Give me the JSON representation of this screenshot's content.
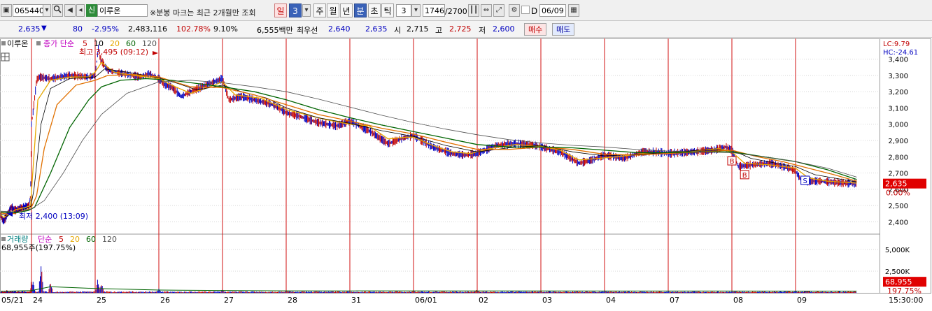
{
  "toolbar": {
    "code_value": "065440",
    "badge": "신",
    "stock_name": "이루온",
    "notice": "※분봉 마크는 최근 2개월만 조회",
    "period_day": "일",
    "period_value": "3",
    "period_week": "주",
    "period_month": "월",
    "period_year": "년",
    "period_minute": "분",
    "period_second": "초",
    "period_tick": "틱",
    "interval_value": "3",
    "count_display": "1746",
    "count_total": "/2700",
    "date_flag": "D",
    "date_value": "06/09"
  },
  "quote": {
    "price": "2,635",
    "change_arrow": "▼",
    "change": "80",
    "change_pct": "-2.95%",
    "volume": "2,483,116",
    "volume_ratio": "102.78%",
    "turnover": "9.10%",
    "amount": "6,555백만",
    "ask_label": "최우선",
    "ask": "2,640",
    "bid": "2,635",
    "open_label": "시",
    "open": "2,715",
    "high_label": "고",
    "high": "2,725",
    "low_label": "저",
    "low": "2,600",
    "buy_label": "매수",
    "sell_label": "매도"
  },
  "colors": {
    "up": "#c00000",
    "down": "#0000c0",
    "ma5": "#e6a800",
    "ma10": "#000000",
    "ma20": "#e07000",
    "ma60": "#006400",
    "ma120": "#505050",
    "vline": "#d01010",
    "grid": "#d8d8d8",
    "price_tag_bg": "#e00000"
  },
  "icons": [
    "window-icon",
    "dropdown-arrow-icon",
    "search-icon",
    "speaker-icon",
    "prev-icon",
    "next-icon",
    "candle-icon",
    "fit-icon",
    "settings-icon",
    "calendar-icon"
  ],
  "chart_data": {
    "type": "line",
    "main_legend": {
      "name": "이루온",
      "kind": "종가 단순",
      "ma": [
        "5",
        "10",
        "20",
        "60",
        "120"
      ]
    },
    "right_info": {
      "lc": "LC:9.79",
      "hc": "HC:-24.61"
    },
    "annotations": {
      "max_label": "최고 3,495 (09:12)",
      "min_label": "최저 2,400 (13:09)"
    },
    "price_ticks": [
      "3,400",
      "3,300",
      "3,200",
      "3,100",
      "3,000",
      "2,900",
      "2,800",
      "2,700",
      "2,600",
      "2,500",
      "2,400"
    ],
    "price_tick_values": [
      3400,
      3300,
      3200,
      3100,
      3000,
      2900,
      2800,
      2700,
      2600,
      2500,
      2400
    ],
    "last_price_label": "2,635",
    "last_pct_label": "0.00%",
    "volume_legend": {
      "name": "거래량",
      "kind": "단순",
      "ma": [
        "5",
        "20",
        "60",
        "120"
      ],
      "value": "68,955주(197.75%)"
    },
    "volume_ticks": [
      "5,000K",
      "2,500K"
    ],
    "volume_tick_values": [
      5000,
      2500
    ],
    "last_volume_label": "68,955",
    "last_volume_pct_label": "197.75%",
    "x_labels": [
      "05/21",
      "24",
      "25",
      "26",
      "27",
      "28",
      "31",
      "06/01",
      "02",
      "03",
      "04",
      "07",
      "08",
      "09"
    ],
    "time_label": "15:30:00",
    "ylim": [
      2350,
      3510
    ],
    "series": [
      {
        "name": "종가",
        "x": [
          0,
          0.05,
          0.1,
          0.2,
          0.28,
          0.35,
          0.45,
          0.6,
          0.8,
          0.92,
          0.97,
          1.0,
          1.03,
          1.08,
          1.12,
          1.3,
          1.6,
          1.9,
          2.0,
          2.05,
          2.08,
          2.2,
          2.45,
          2.7,
          2.85,
          3.0,
          3.1,
          3.2,
          3.35,
          3.5,
          3.8,
          4.0,
          4.1,
          4.3,
          4.5,
          4.8,
          5.0,
          5.2,
          5.5,
          5.8,
          6.0,
          6.3,
          6.6,
          6.8,
          7.0,
          7.3,
          7.6,
          7.8,
          8.0,
          8.3,
          8.6,
          8.9,
          9.0,
          9.3,
          9.6,
          9.8,
          10.0,
          10.3,
          10.6,
          10.8,
          11.0,
          11.4,
          11.7,
          11.9,
          12.0,
          12.1,
          12.3,
          12.6,
          12.9,
          13.0,
          13.1,
          13.4,
          13.7,
          13.96
        ],
        "values": [
          2440,
          2415,
          2405,
          2440,
          2470,
          2490,
          2470,
          2480,
          2495,
          2500,
          2560,
          3000,
          3090,
          3270,
          3290,
          3280,
          3300,
          3290,
          3300,
          3470,
          3400,
          3330,
          3310,
          3290,
          3310,
          3280,
          3240,
          3230,
          3170,
          3200,
          3250,
          3280,
          3150,
          3170,
          3150,
          3120,
          3070,
          3050,
          3010,
          2990,
          3020,
          2960,
          2880,
          2910,
          2930,
          2860,
          2820,
          2810,
          2820,
          2870,
          2880,
          2870,
          2860,
          2830,
          2760,
          2780,
          2810,
          2790,
          2830,
          2830,
          2820,
          2830,
          2840,
          2860,
          2840,
          2740,
          2750,
          2760,
          2730,
          2710,
          2650,
          2650,
          2640,
          2635
        ]
      },
      {
        "name": "5",
        "x": [
          0,
          0.1,
          0.3,
          0.5,
          0.8,
          0.97,
          1.02,
          1.1,
          1.3,
          1.6,
          1.9,
          2.0,
          2.1,
          2.3,
          2.6,
          3.0,
          3.2,
          3.5,
          3.8,
          4.0,
          4.2,
          4.6,
          5.0,
          5.3,
          5.6,
          6.0,
          6.3,
          6.6,
          6.9,
          7.0,
          7.3,
          7.6,
          7.9,
          8.2,
          8.6,
          9.0,
          9.3,
          9.6,
          9.9,
          10.2,
          10.6,
          11.0,
          11.4,
          11.8,
          12.0,
          12.2,
          12.6,
          13.0,
          13.2,
          13.5,
          13.96
        ],
        "values": [
          2445,
          2425,
          2455,
          2475,
          2488,
          2500,
          2700,
          3150,
          3270,
          3290,
          3290,
          3320,
          3380,
          3320,
          3300,
          3280,
          3240,
          3190,
          3230,
          3260,
          3180,
          3160,
          3090,
          3060,
          3030,
          3000,
          2990,
          2910,
          2920,
          2920,
          2870,
          2830,
          2820,
          2850,
          2875,
          2865,
          2840,
          2780,
          2790,
          2800,
          2820,
          2825,
          2835,
          2850,
          2830,
          2760,
          2750,
          2730,
          2670,
          2650,
          2638
        ]
      },
      {
        "name": "10",
        "x": [
          0,
          0.2,
          0.5,
          0.8,
          0.98,
          1.04,
          1.15,
          1.3,
          1.6,
          2.0,
          2.15,
          2.5,
          3.0,
          3.3,
          3.6,
          4.0,
          4.3,
          4.7,
          5.0,
          5.5,
          6.0,
          6.5,
          7.0,
          7.5,
          8.0,
          8.5,
          9.0,
          9.5,
          10.0,
          10.5,
          11.0,
          11.5,
          12.0,
          12.3,
          12.7,
          13.0,
          13.3,
          13.96
        ],
        "values": [
          2450,
          2435,
          2460,
          2480,
          2495,
          2600,
          3000,
          3220,
          3280,
          3290,
          3340,
          3320,
          3285,
          3250,
          3210,
          3240,
          3200,
          3160,
          3100,
          3040,
          3005,
          2960,
          2925,
          2870,
          2830,
          2855,
          2870,
          2830,
          2805,
          2815,
          2825,
          2840,
          2840,
          2790,
          2760,
          2740,
          2690,
          2645
        ]
      },
      {
        "name": "20",
        "x": [
          0,
          0.3,
          0.6,
          0.9,
          1.0,
          1.08,
          1.2,
          1.4,
          1.7,
          2.0,
          2.2,
          2.6,
          3.0,
          3.5,
          4.0,
          4.5,
          5.0,
          5.5,
          6.0,
          6.5,
          7.0,
          7.5,
          8.0,
          8.5,
          9.0,
          9.5,
          10.0,
          10.5,
          11.0,
          11.5,
          12.0,
          12.4,
          12.8,
          13.2,
          13.6,
          13.96
        ],
        "values": [
          2455,
          2445,
          2460,
          2478,
          2490,
          2560,
          2850,
          3120,
          3240,
          3270,
          3300,
          3305,
          3290,
          3230,
          3225,
          3180,
          3120,
          3060,
          3020,
          2975,
          2940,
          2890,
          2845,
          2845,
          2860,
          2845,
          2815,
          2810,
          2820,
          2830,
          2840,
          2800,
          2770,
          2730,
          2690,
          2650
        ]
      },
      {
        "name": "60",
        "x": [
          0,
          0.5,
          0.9,
          1.05,
          1.3,
          1.6,
          1.9,
          2.1,
          2.4,
          2.8,
          3.2,
          3.6,
          4.0,
          4.5,
          5.0,
          5.5,
          6.0,
          6.5,
          7.0,
          7.5,
          8.0,
          8.5,
          9.0,
          9.5,
          10.0,
          10.5,
          11.0,
          11.5,
          12.0,
          12.5,
          13.0,
          13.5,
          13.96
        ],
        "values": [
          2460,
          2455,
          2470,
          2490,
          2700,
          2980,
          3150,
          3230,
          3270,
          3280,
          3270,
          3250,
          3230,
          3200,
          3150,
          3090,
          3040,
          2995,
          2955,
          2915,
          2875,
          2860,
          2860,
          2855,
          2840,
          2825,
          2825,
          2830,
          2830,
          2800,
          2770,
          2720,
          2660
        ]
      },
      {
        "name": "120",
        "x": [
          0,
          0.6,
          1.0,
          1.2,
          1.5,
          1.8,
          2.1,
          2.5,
          3.0,
          3.5,
          4.0,
          4.5,
          5.0,
          5.5,
          6.0,
          6.5,
          7.0,
          7.5,
          8.0,
          8.5,
          9.0,
          9.5,
          10.0,
          10.5,
          11.0,
          11.5,
          12.0,
          12.5,
          13.0,
          13.5,
          13.96
        ],
        "values": [
          2465,
          2460,
          2480,
          2530,
          2700,
          2900,
          3060,
          3190,
          3260,
          3270,
          3255,
          3230,
          3200,
          3155,
          3105,
          3055,
          3010,
          2970,
          2935,
          2905,
          2885,
          2870,
          2860,
          2845,
          2835,
          2830,
          2825,
          2800,
          2770,
          2730,
          2675
        ]
      }
    ],
    "trade_marks": [
      {
        "x": 12.0,
        "price": 2775,
        "label": "B"
      },
      {
        "x": 12.2,
        "price": 2690,
        "label": "B"
      },
      {
        "x": 13.15,
        "price": 2655,
        "label": "S"
      }
    ],
    "volume_peaks": [
      {
        "x": 0.2,
        "value": 400
      },
      {
        "x": 0.7,
        "value": 350
      },
      {
        "x": 1.0,
        "value": 2200
      },
      {
        "x": 1.02,
        "value": 1600
      },
      {
        "x": 1.15,
        "value": 3700
      },
      {
        "x": 1.3,
        "value": 1500
      },
      {
        "x": 2.04,
        "value": 1800
      },
      {
        "x": 2.1,
        "value": 1200
      },
      {
        "x": 3.0,
        "value": 600
      },
      {
        "x": 4.0,
        "value": 500
      },
      {
        "x": 5.0,
        "value": 300
      },
      {
        "x": 7.0,
        "value": 350
      },
      {
        "x": 8.0,
        "value": 500
      },
      {
        "x": 9.0,
        "value": 250
      },
      {
        "x": 10.0,
        "value": 300
      },
      {
        "x": 12.0,
        "value": 250
      },
      {
        "x": 13.0,
        "value": 320
      },
      {
        "x": 13.96,
        "value": 69
      }
    ]
  }
}
